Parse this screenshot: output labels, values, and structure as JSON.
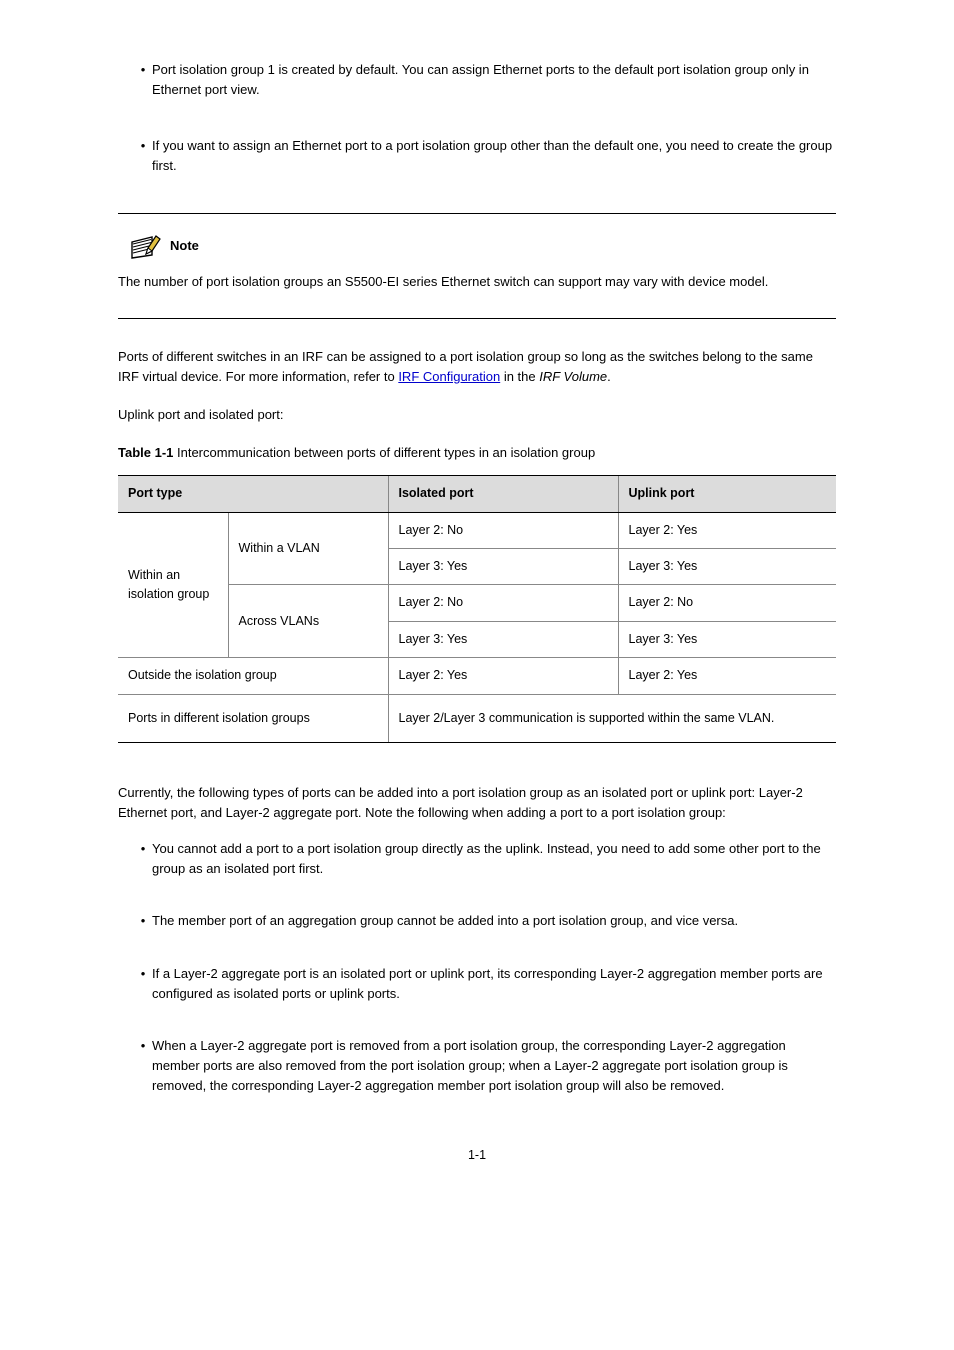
{
  "bullets_top": [
    "Port isolation group 1 is created by default. You can assign Ethernet ports to the default port isolation group only in Ethernet port view.",
    "If you want to assign an Ethernet port to a port isolation group other than the default one, you need to create the group first."
  ],
  "note": {
    "label": "Note",
    "body": "The number of port isolation groups an S5500-EI series Ethernet switch can support may vary with device model."
  },
  "para_after_note_1": "Ports of different switches in an IRF can be assigned to a port isolation group so long as the switches belong to the same IRF virtual device. For more information, refer to ",
  "para_after_note_link": "IRF Configuration",
  "para_after_note_2": " in the ",
  "para_after_note_italic": "IRF Volume",
  "para_after_note_3": ".",
  "isolation_label": "Uplink port and isolated port:",
  "table_title": "Table 1-1",
  "table_title_rest": " Intercommunication between ports of different types in an isolation group",
  "table": {
    "headers": [
      "Port type",
      "Isolated port",
      "Uplink port"
    ],
    "group_label": "Within an isolation group",
    "rows": [
      {
        "sub": "Within a VLAN",
        "iso": "Layer 2: No",
        "up": "Layer 2: Yes"
      },
      {
        "sub": "Within a VLAN",
        "iso": "Layer 3: Yes",
        "up": "Layer 3: Yes"
      },
      {
        "sub": "Across VLANs",
        "iso": "Layer 2: No",
        "up": "Layer 2: No"
      },
      {
        "sub": "Across VLANs",
        "iso": "Layer 3: Yes",
        "up": "Layer 3: Yes"
      }
    ],
    "outside_label": "Outside the isolation group",
    "outside_iso": "Layer 2: Yes",
    "outside_up": "Layer 2: Yes",
    "across_groups_label": "Ports in different isolation groups",
    "across_groups_value": "Layer 2/Layer 3 communication is supported within the same VLAN."
  },
  "compat_heading": "Currently, the following types of ports can be added into a port isolation group as an isolated port or uplink port: Layer-2 Ethernet port, and Layer-2 aggregate port. Note the following when adding a port to a port isolation group:",
  "compat_items": [
    "You cannot add a port to a port isolation group directly as the uplink. Instead, you need to add some other port to the group as an isolated port first.",
    "The member port of an aggregation group cannot be added into a port isolation group, and vice versa.",
    "If a Layer-2 aggregate port is an isolated port or uplink port, its corresponding Layer-2 aggregation member ports are configured as isolated ports or uplink ports.",
    "When a Layer-2 aggregate port is removed from a port isolation group, the corresponding Layer-2 aggregation member ports are also removed from the port isolation group; when a Layer-2 aggregate port isolation group is removed, the corresponding Layer-2 aggregation member port isolation group will also be removed."
  ],
  "page_number": "1-1"
}
